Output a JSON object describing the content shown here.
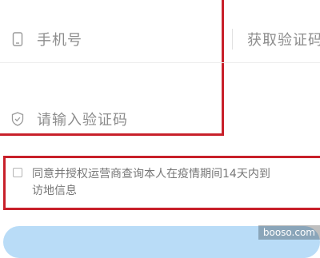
{
  "form": {
    "phone_placeholder": "手机号",
    "get_code_label": "获取验证码",
    "code_placeholder": "请输入验证码"
  },
  "consent": {
    "text": "同意并授权运营商查询本人在疫情期间14天内到\n访地信息"
  },
  "watermark": "booso.com",
  "colors": {
    "highlight_box": "#c8202a",
    "submit_button": "#b9dcf7",
    "placeholder_text": "#8d8d8d"
  }
}
